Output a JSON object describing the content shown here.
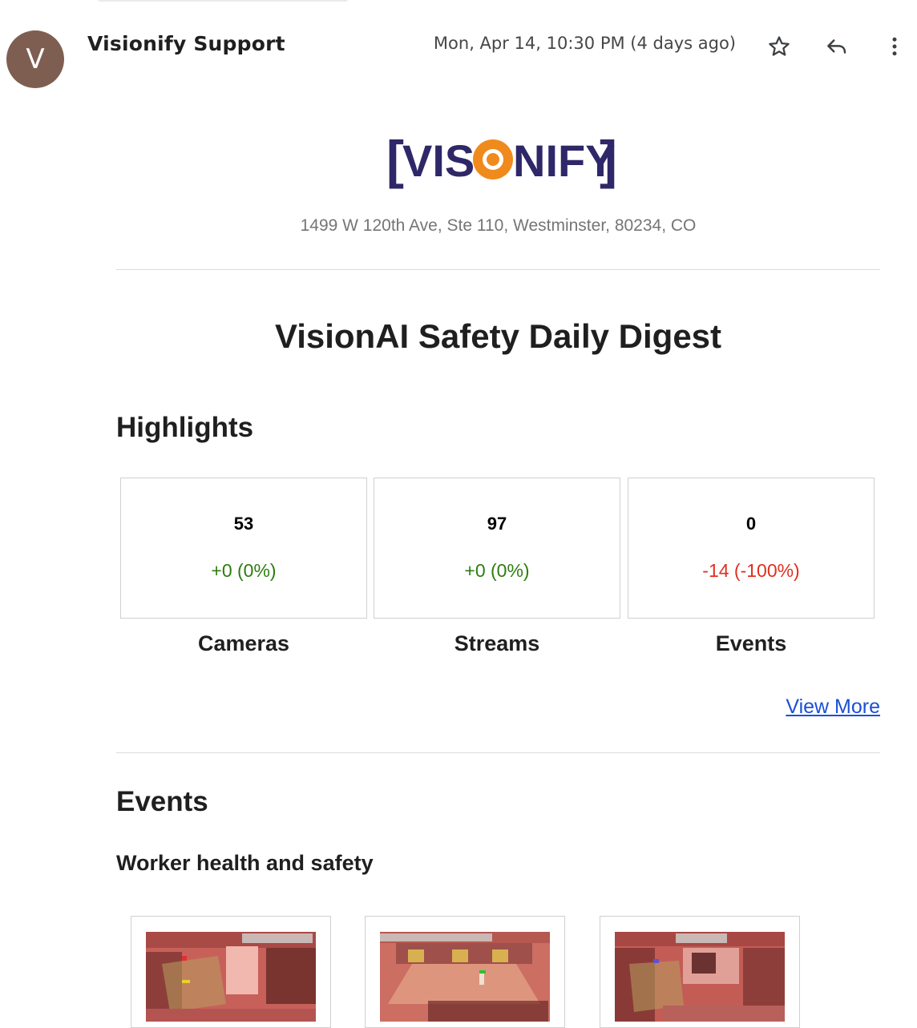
{
  "header": {
    "avatar_letter": "V",
    "sender_name": "Visionify Support",
    "date": "Mon, Apr 14, 10:30 PM (4 days ago)",
    "actions": [
      "star-icon",
      "reply-icon",
      "more-vert-icon"
    ]
  },
  "brand": {
    "logo_text_left": "VIS",
    "logo_text_right": "NIFY",
    "colors": {
      "navy": "#2e2768",
      "orange": "#f08a1c"
    },
    "address": "1499 W 120th Ave, Ste 110, Westminster, 80234, CO"
  },
  "digest": {
    "title": "VisionAI Safety Daily Digest",
    "highlights_heading": "Highlights",
    "stats": [
      {
        "value": "53",
        "change": "+0 (0%)",
        "trend": "positive",
        "label": "Cameras"
      },
      {
        "value": "97",
        "change": "+0 (0%)",
        "trend": "positive",
        "label": "Streams"
      },
      {
        "value": "0",
        "change": "-14 (-100%)",
        "trend": "negative",
        "label": "Events"
      }
    ],
    "view_more": "View More",
    "events_heading": "Events",
    "category_heading": "Worker health and safety"
  },
  "colors": {
    "positive": "#2d7d10",
    "negative": "#e0301e",
    "link": "#1a4fd6"
  }
}
